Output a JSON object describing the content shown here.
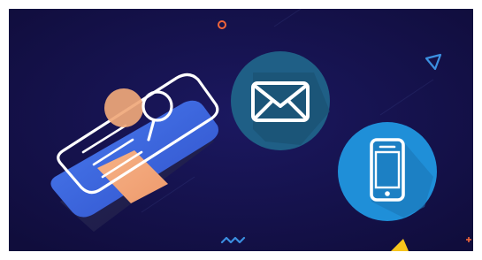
{
  "scene": {
    "background_color": "#14114a",
    "accent_colors": {
      "phone_panel": "#3b63e0",
      "phone_outline": "#ffffff",
      "search_circle": "#f0a87a",
      "envelope_badge": "#1f5f86",
      "phone_badge": "#1f8fd8",
      "decor_orange": "#f0653a",
      "decor_blue": "#3b8fe0",
      "decor_yellow": "#f7c51c"
    },
    "icons": [
      "isometric-phone-illustration",
      "magnifier-icon",
      "envelope-icon",
      "smartphone-icon",
      "circle-decoration",
      "triangle-decoration",
      "zigzag-decoration",
      "plus-decoration"
    ]
  }
}
